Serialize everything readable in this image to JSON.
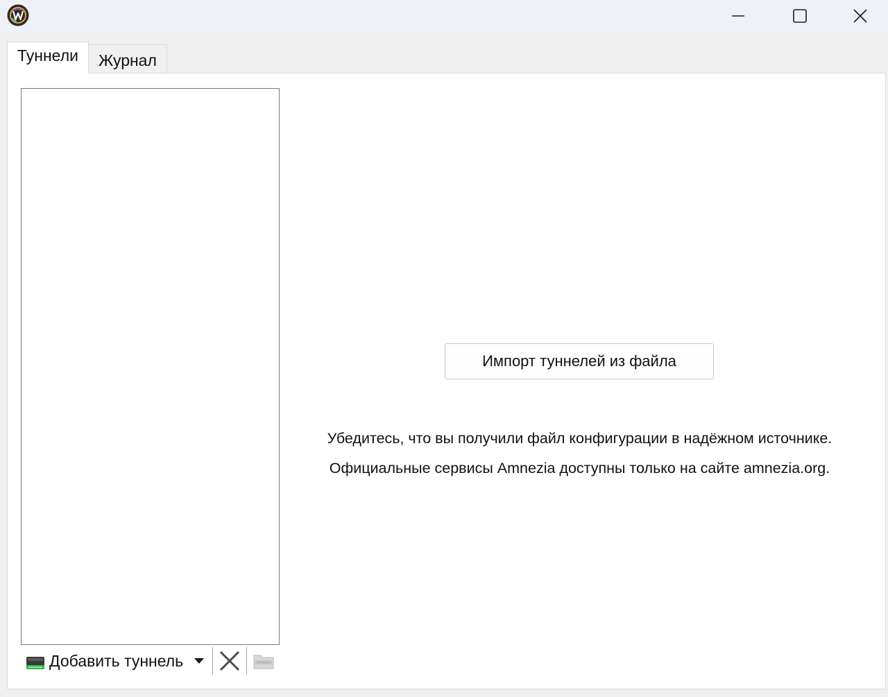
{
  "window": {
    "app_icon": "amnezia-wg-logo-icon",
    "controls": {
      "minimize": "minimize-icon",
      "maximize": "maximize-icon",
      "close": "close-icon"
    }
  },
  "tabs": [
    {
      "label": "Туннели",
      "active": true
    },
    {
      "label": "Журнал",
      "active": false
    }
  ],
  "tunnels": {
    "items": [],
    "toolbar": {
      "add_label": "Добавить туннель",
      "add_icon": "add-tunnel-icon",
      "dropdown_icon": "dropdown-arrow-icon",
      "delete_icon": "delete-x-icon",
      "export_icon": "export-zip-icon"
    }
  },
  "main": {
    "import_button": "Импорт туннелей из файла",
    "notice_line1": "Убедитесь, что вы получили файл конфигурации в надёжном источнике.",
    "notice_line2": "Официальные сервисы Amnezia доступны только на сайте amnezia.org."
  },
  "colors": {
    "titlebar": "#eef1f8",
    "window_bg": "#f0f0f0",
    "pane_bg": "#ffffff"
  }
}
